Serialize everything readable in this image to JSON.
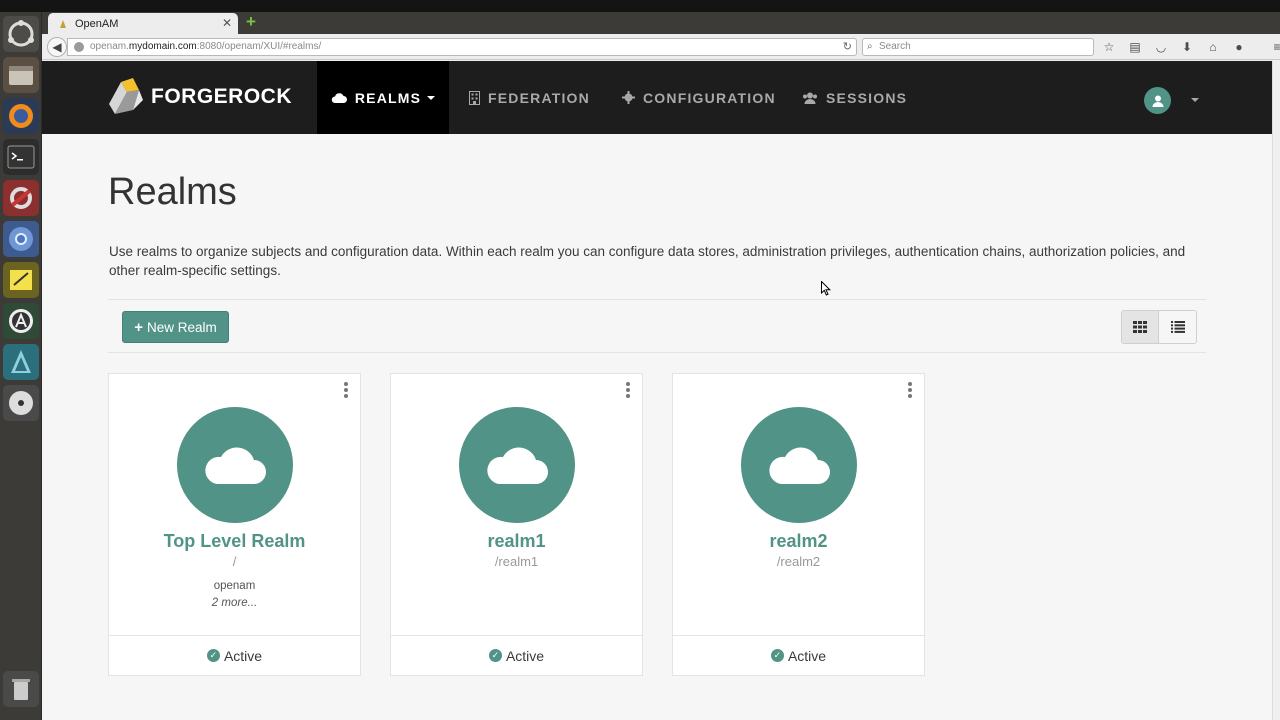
{
  "launcher": {
    "items": [
      "ubuntu-home-icon",
      "file-manager-icon",
      "firefox-icon",
      "terminal-icon",
      "settings-tools-icon",
      "chromium-icon",
      "notes-icon",
      "software-updater-icon",
      "app-icon",
      "disc-icon",
      "trash-icon"
    ]
  },
  "browser": {
    "tab_title": "OpenAM",
    "url_prefix": "openam.",
    "url_host": "mydomain.com",
    "url_rest": ":8080/openam/XUI/#realms/",
    "search_placeholder": "Search"
  },
  "app": {
    "brand": "FORGEROCK",
    "nav": {
      "realms": "REALMS",
      "federation": "FEDERATION",
      "configuration": "CONFIGURATION",
      "sessions": "SESSIONS"
    }
  },
  "page": {
    "title": "Realms",
    "description": "Use realms to organize subjects and configuration data. Within each realm you can configure data stores, administration privileges, authentication chains, authorization policies, and other realm-specific settings.",
    "new_realm_label": "New Realm"
  },
  "realms": [
    {
      "name": "Top Level Realm",
      "path": "/",
      "alias": "openam",
      "more": "2 more...",
      "status": "Active"
    },
    {
      "name": "realm1",
      "path": "/realm1",
      "status": "Active"
    },
    {
      "name": "realm2",
      "path": "/realm2",
      "status": "Active"
    }
  ],
  "colors": {
    "accent": "#519387",
    "nav_background": "#1d1d1d",
    "page_background": "#f6f6f6"
  }
}
